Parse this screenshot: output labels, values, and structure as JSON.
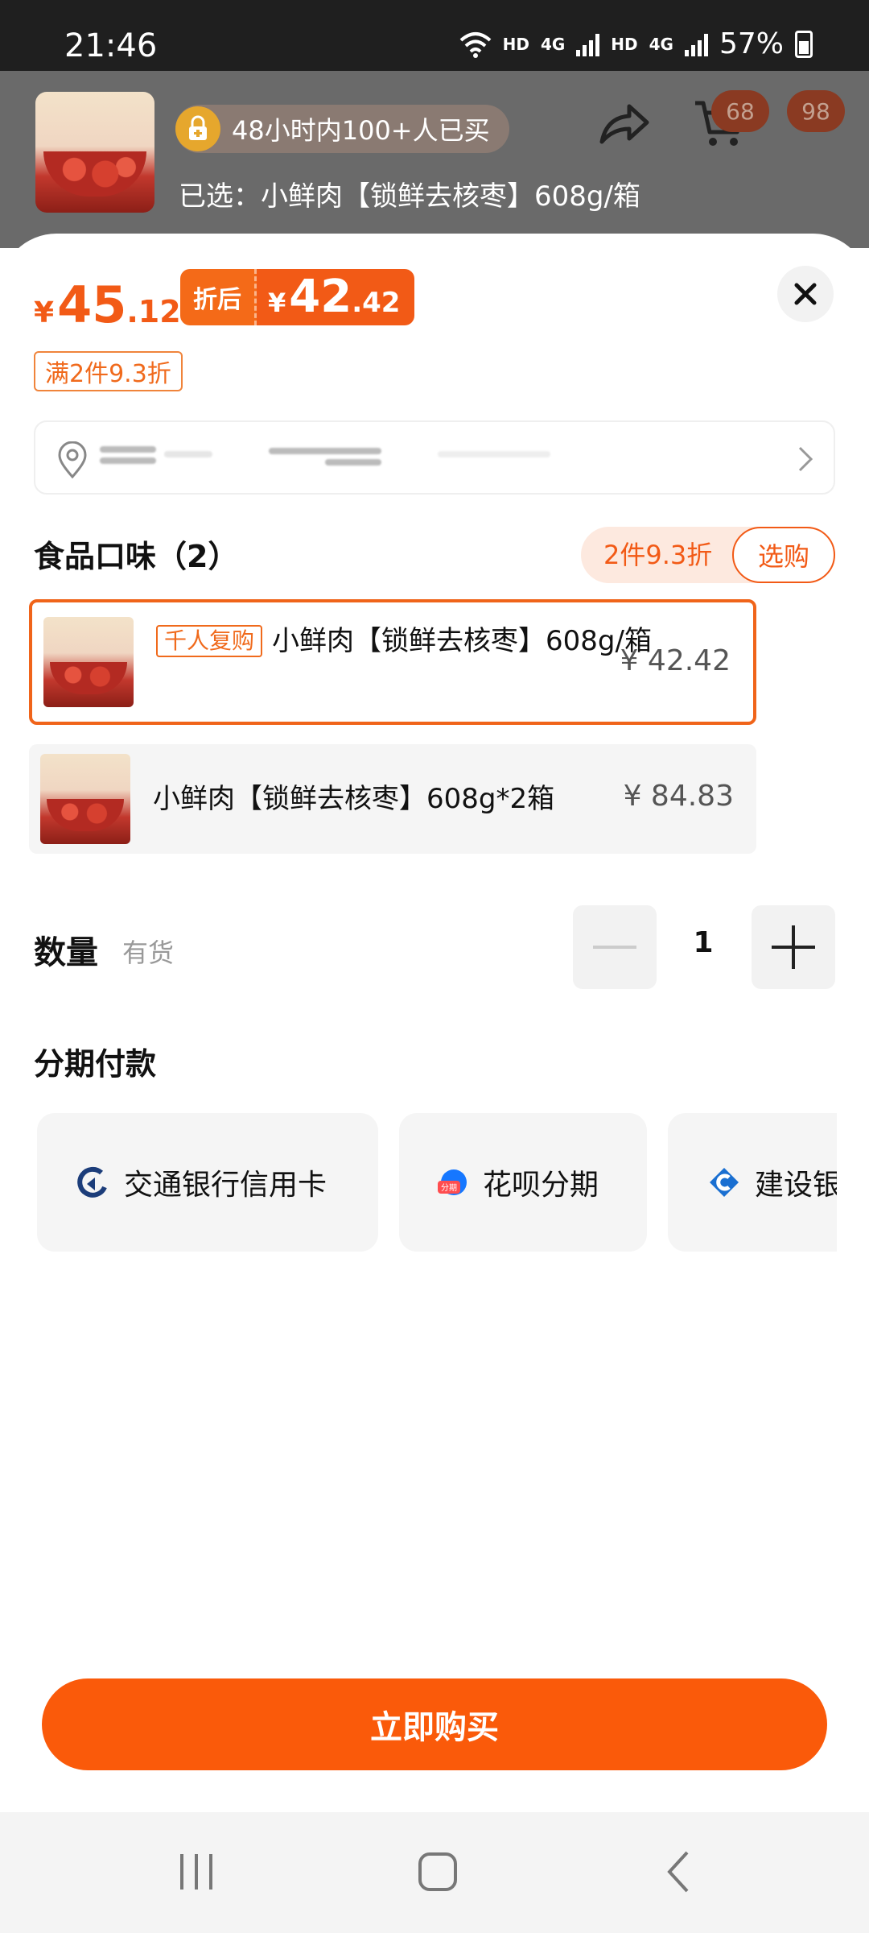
{
  "status_bar": {
    "time": "21:46",
    "hd1": "HD",
    "net1": "4G",
    "hd2": "HD",
    "net2": "4G",
    "battery": "57%"
  },
  "header": {
    "bought_text": "48小时内100+人已买",
    "selected_text": "已选：小鲜肉【锁鲜去核枣】608g/箱",
    "share_badge": "68",
    "cart_badge": "98"
  },
  "price": {
    "currency": "¥",
    "original_int": "45",
    "original_dec": ".12",
    "after_label": "折后",
    "after_int": "42",
    "after_dec": ".42",
    "promo_tag": "满2件9.3折"
  },
  "flavor": {
    "title": "食品口味（2）",
    "discount_text": "2件9.3折",
    "select_button": "选购",
    "options": [
      {
        "tag": "千人复购",
        "name": "小鲜肉【锁鲜去核枣】608g/箱",
        "price": "¥ 42.42",
        "selected": true
      },
      {
        "tag": "",
        "name": "小鲜肉【锁鲜去核枣】608g*2箱",
        "price": "¥ 84.83",
        "selected": false
      }
    ]
  },
  "quantity": {
    "label": "数量",
    "stock": "有货",
    "value": "1"
  },
  "installment": {
    "title": "分期付款",
    "options": [
      {
        "name": "交通银行信用卡",
        "icon": "bocom-icon"
      },
      {
        "name": "花呗分期",
        "icon": "huabei-icon"
      },
      {
        "name": "建设银",
        "icon": "ccb-icon"
      }
    ]
  },
  "buy_button": "立即购买",
  "colors": {
    "accent": "#fa5a0a",
    "accent_light": "#fde9df",
    "status_bar": "#1f1f1f"
  }
}
